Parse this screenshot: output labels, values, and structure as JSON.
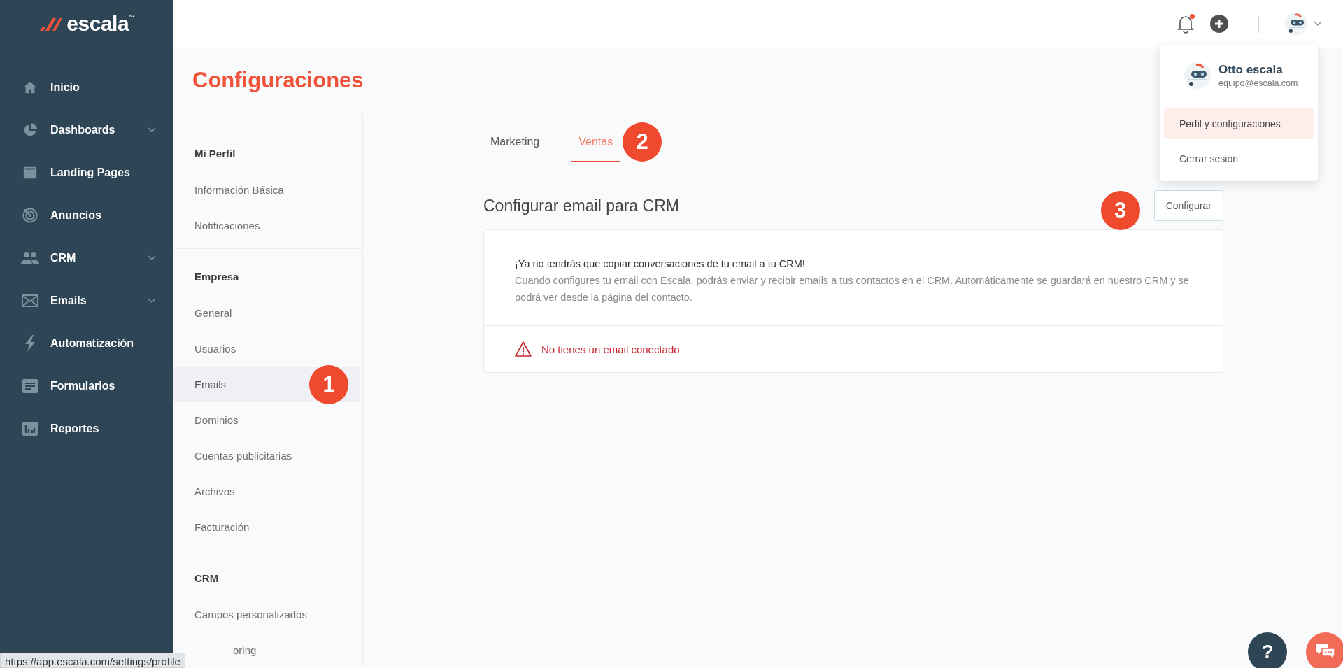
{
  "sidebar": {
    "logo": {
      "text": "escala",
      "mark": "™"
    },
    "items": [
      {
        "label": "Inicio",
        "expandable": false
      },
      {
        "label": "Dashboards",
        "expandable": true
      },
      {
        "label": "Landing Pages",
        "expandable": false
      },
      {
        "label": "Anuncios",
        "expandable": false
      },
      {
        "label": "CRM",
        "expandable": true
      },
      {
        "label": "Emails",
        "expandable": true
      },
      {
        "label": "Automatización",
        "expandable": false
      },
      {
        "label": "Formularios",
        "expandable": false
      },
      {
        "label": "Reportes",
        "expandable": false
      }
    ]
  },
  "topbar": {
    "notifications_unread": true
  },
  "user_menu": {
    "name": "Otto escala",
    "email": "equipo@escala.com",
    "items": [
      {
        "label": "Perfil y configuraciones",
        "selected": true
      },
      {
        "label": "Cerrar sesión",
        "selected": false
      }
    ]
  },
  "page_title": "Configuraciones",
  "settings_menu": [
    {
      "heading": "Mi Perfil",
      "items": [
        {
          "label": "Información Básica",
          "selected": false
        },
        {
          "label": "Notificaciones",
          "selected": false
        }
      ]
    },
    {
      "heading": "Empresa",
      "items": [
        {
          "label": "General",
          "selected": false
        },
        {
          "label": "Usuarios",
          "selected": false
        },
        {
          "label": "Emails",
          "selected": true,
          "annotation": "1"
        },
        {
          "label": "Dominios",
          "selected": false
        },
        {
          "label": "Cuentas publicitarias",
          "selected": false
        },
        {
          "label": "Archivos",
          "selected": false
        },
        {
          "label": "Facturación",
          "selected": false
        }
      ]
    },
    {
      "heading": "CRM",
      "items": [
        {
          "label": "Campos personalizados",
          "selected": false
        },
        {
          "label": "oring",
          "selected": false,
          "covered": true
        }
      ]
    }
  ],
  "tabs": [
    {
      "label": "Marketing",
      "selected": false
    },
    {
      "label": "Ventas",
      "selected": true,
      "annotation": "2"
    }
  ],
  "section": {
    "title": "Configurar email para CRM",
    "button": {
      "label": "Configurar",
      "annotation": "3"
    },
    "card": {
      "headline": "¡Ya no tendrás que copiar conversaciones de tu email a tu CRM!",
      "description": "Cuando configures tu email con Escala, podrás enviar y recibir emails a tus contactos en el CRM. Automáticamente se guardará en nuestro CRM y se podrá ver desde la página del contacto.",
      "warning": "No tienes un email conectado"
    }
  },
  "help_button": "?",
  "status_url": "https://app.escala.com/settings/profile"
}
